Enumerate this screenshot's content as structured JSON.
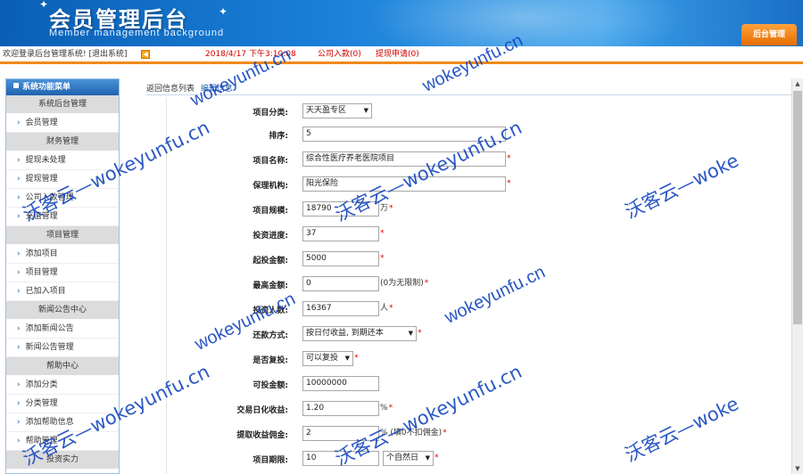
{
  "header": {
    "title_cn": "会员管理后台",
    "title_en": "Member management background",
    "admin_tab": "后台管理"
  },
  "statusbar": {
    "welcome": "欢迎登录后台管理系统! [退出系统]",
    "datetime": "2018/4/17 下午3:10:08",
    "company_joins": "公司入款(0)",
    "withdraw_requests": "提现申请(0)"
  },
  "sidebar": {
    "title": "系统功能菜单",
    "sections": [
      {
        "group": "系统后台管理",
        "items": [
          "会员管理"
        ]
      },
      {
        "group": "财务管理",
        "items": [
          "提现未处理",
          "提现管理",
          "公司入款管理",
          "充值管理"
        ]
      },
      {
        "group": "项目管理",
        "items": [
          "添加项目",
          "项目管理",
          "已加入项目"
        ]
      },
      {
        "group": "新闻公告中心",
        "items": [
          "添加新闻公告",
          "新闻公告管理"
        ]
      },
      {
        "group": "帮助中心",
        "items": [
          "添加分类",
          "分类管理",
          "添加帮助信息",
          "帮助管理"
        ]
      },
      {
        "group": "投资实力",
        "items": []
      }
    ]
  },
  "breadcrumb": {
    "back": "返回信息列表",
    "edit": "编辑信息"
  },
  "form": {
    "category": {
      "label": "项目分类:",
      "value": "天天盈专区"
    },
    "sort": {
      "label": "排序:",
      "value": "5"
    },
    "name": {
      "label": "项目名称:",
      "value": "综合性医疗养老医院项目",
      "required": "*"
    },
    "insurer": {
      "label": "保理机构:",
      "value": "阳光保险",
      "required": "*"
    },
    "scale": {
      "label": "项目规模:",
      "value": "18790",
      "unit": "万",
      "required": "*"
    },
    "progress": {
      "label": "投资进度:",
      "value": "37",
      "required": "*"
    },
    "min_invest": {
      "label": "起投金额:",
      "value": "5000",
      "required": "*"
    },
    "max_invest": {
      "label": "最高金额:",
      "value": "0",
      "note": "(0为无限制)",
      "required": "*"
    },
    "investors": {
      "label": "投资人数:",
      "value": "16367",
      "unit": "人",
      "required": "*"
    },
    "repayment": {
      "label": "还款方式:",
      "value": "按日付收益, 到期还本",
      "required": "*"
    },
    "reinvest": {
      "label": "是否复投:",
      "value": "可以复投",
      "required": "*"
    },
    "investable": {
      "label": "可投金额:",
      "value": "10000000"
    },
    "daily_yield": {
      "label": "交易日化收益:",
      "value": "1.20",
      "unit": "%",
      "required": "*"
    },
    "commission": {
      "label": "提取收益佣金:",
      "value": "2",
      "note": "% (填0不扣佣金)",
      "required": "*"
    },
    "term": {
      "label": "项目期限:",
      "value": "10",
      "unit_select": "个自然日",
      "required": "*"
    }
  },
  "watermarks": {
    "cn": "沃客云—wokeyunfu.cn",
    "cn_short": "沃客云—woke",
    "url": "wokeyunfu.cn"
  }
}
